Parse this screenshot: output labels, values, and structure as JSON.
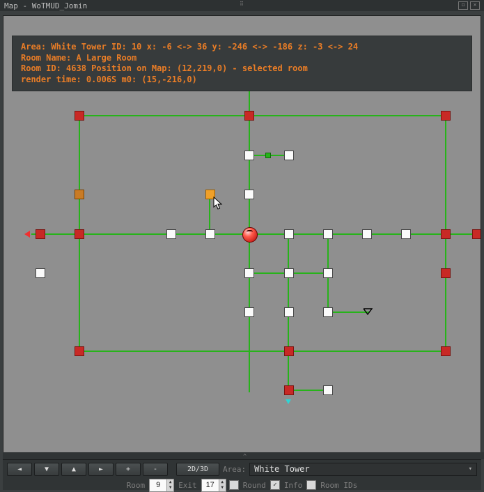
{
  "window": {
    "title": "Map - WoTMUD_Jomin"
  },
  "info": {
    "line1": "Area: White Tower ID: 10 x: -6 <-> 36 y: -246 <-> -186 z: -3 <-> 24",
    "line2": "Room Name: A Large Room",
    "line3": "Room ID: 4638 Position on Map: (12,219,0) - selected room",
    "line4": "render time: 0.006S m0: (15,-216,0)"
  },
  "toolbar": {
    "left": "◄",
    "down": "▼",
    "up": "▲",
    "right": "►",
    "plus": "+",
    "minus": "-",
    "toggle": "2D/3D",
    "area_label": "Area:",
    "area_value": "White Tower",
    "room_label": "Room",
    "room_value": "9",
    "exit_label": "Exit",
    "exit_value": "17",
    "round_label": "Round",
    "info_label": "Info",
    "roomids_label": "Room IDs",
    "info_checked": true
  }
}
